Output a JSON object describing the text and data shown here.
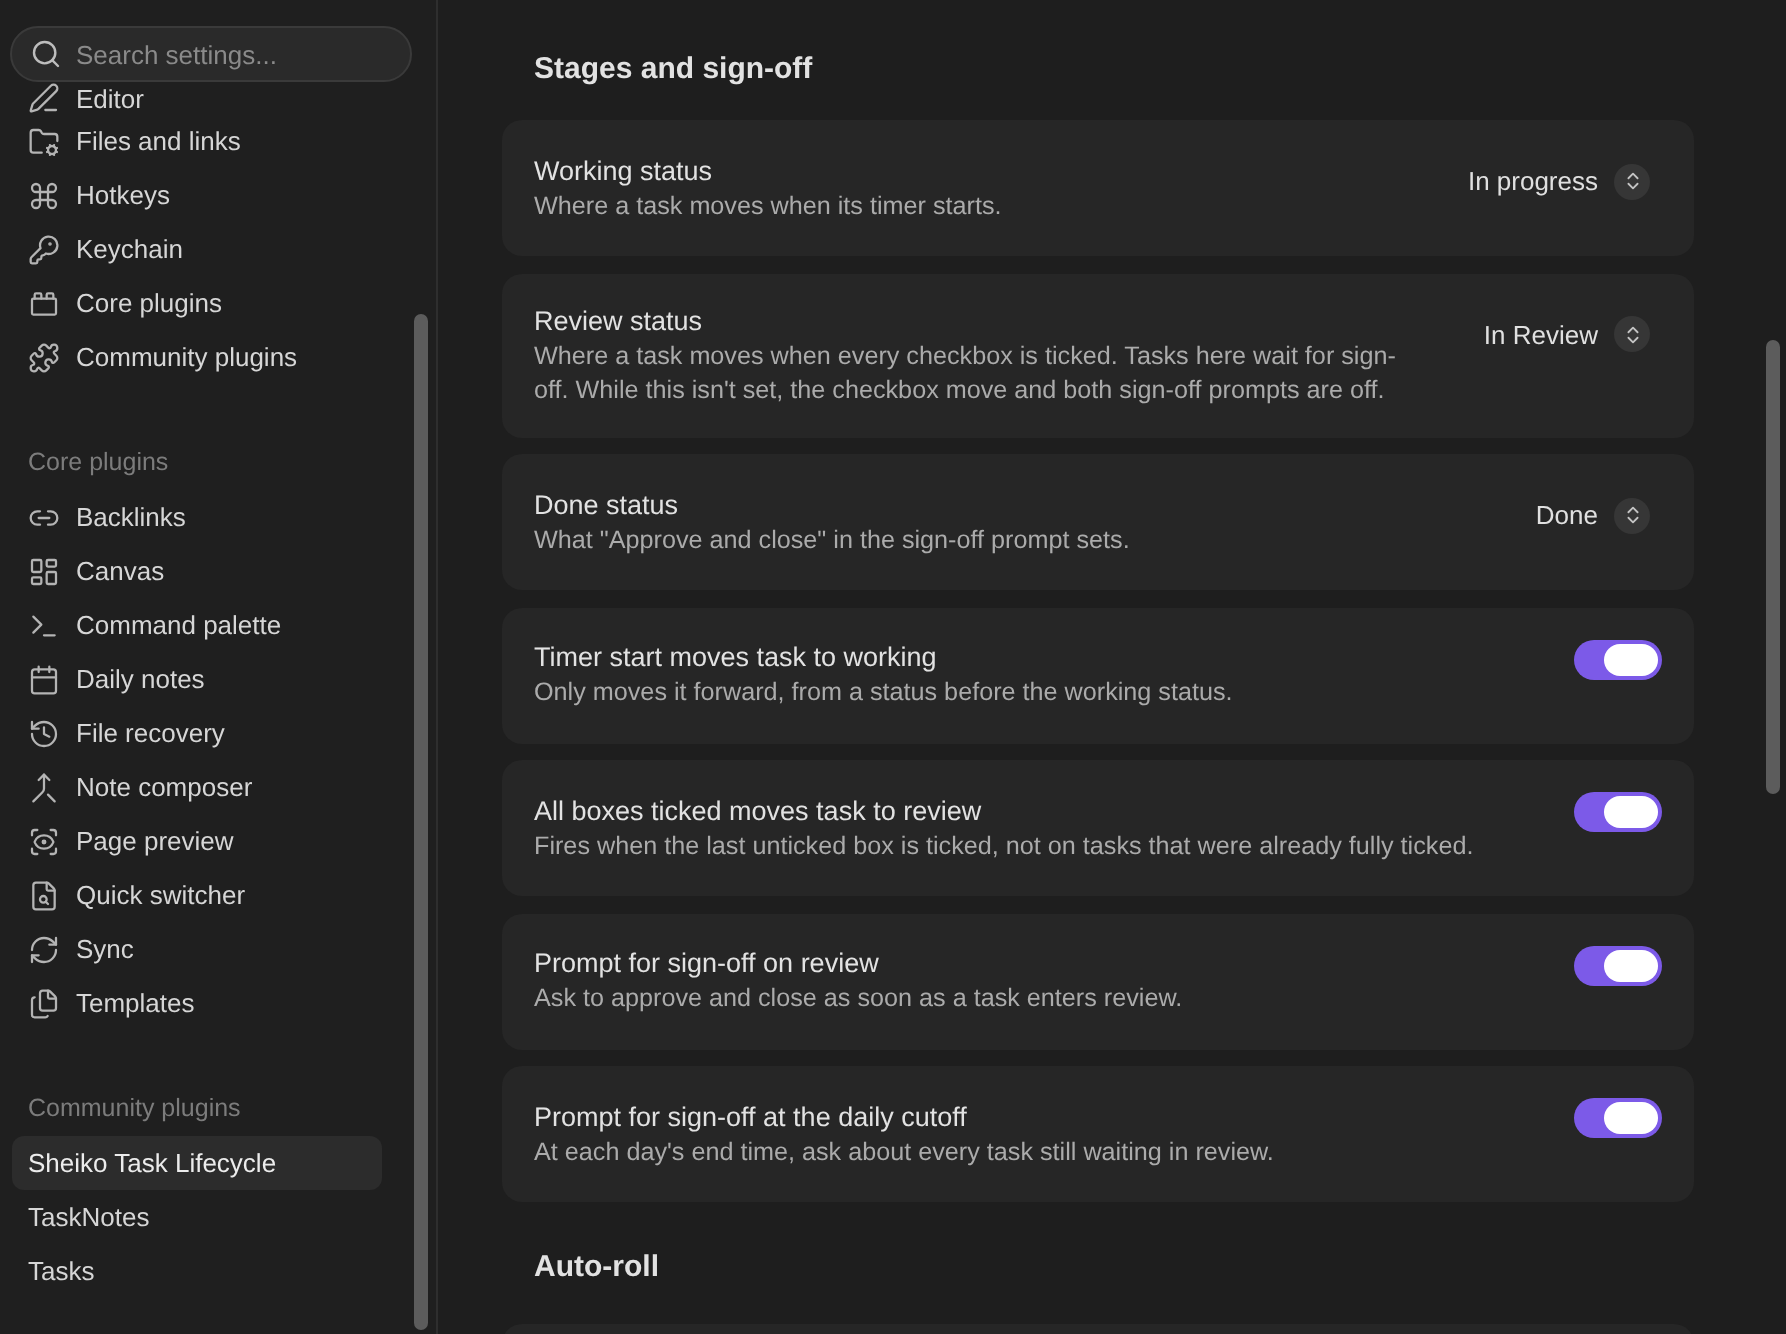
{
  "sidebar": {
    "search": {
      "placeholder": "Search settings..."
    },
    "groups": [
      {
        "items": [
          {
            "label": "Editor",
            "selected": false
          },
          {
            "label": "Files and links",
            "selected": false
          },
          {
            "label": "Hotkeys",
            "selected": false
          },
          {
            "label": "Keychain",
            "selected": false
          },
          {
            "label": "Core plugins",
            "selected": false
          },
          {
            "label": "Community plugins",
            "selected": false
          }
        ]
      },
      {
        "heading": "Core plugins",
        "items": [
          {
            "label": "Backlinks",
            "selected": false
          },
          {
            "label": "Canvas",
            "selected": false
          },
          {
            "label": "Command palette",
            "selected": false
          },
          {
            "label": "Daily notes",
            "selected": false
          },
          {
            "label": "File recovery",
            "selected": false
          },
          {
            "label": "Note composer",
            "selected": false
          },
          {
            "label": "Page preview",
            "selected": false
          },
          {
            "label": "Quick switcher",
            "selected": false
          },
          {
            "label": "Sync",
            "selected": false
          },
          {
            "label": "Templates",
            "selected": false
          }
        ]
      },
      {
        "heading": "Community plugins",
        "items": [
          {
            "label": "Sheiko Task Lifecycle",
            "selected": true
          },
          {
            "label": "TaskNotes",
            "selected": false
          },
          {
            "label": "Tasks",
            "selected": false
          }
        ]
      }
    ]
  },
  "content": {
    "sections": [
      {
        "heading": "Stages and sign-off",
        "settings": [
          {
            "kind": "dropdown",
            "name": "Working status",
            "description": "Where a task moves when its timer starts.",
            "value": "In progress"
          },
          {
            "kind": "dropdown",
            "name": "Review status",
            "description": "Where a task moves when every checkbox is ticked. Tasks here wait for sign-off. While this isn't set, the checkbox move and both sign-off prompts are off.",
            "value": "In Review"
          },
          {
            "kind": "dropdown",
            "name": "Done status",
            "description": "What \"Approve and close\" in the sign-off prompt sets.",
            "value": "Done"
          },
          {
            "kind": "toggle",
            "name": "Timer start moves task to working",
            "description": "Only moves it forward, from a status before the working status.",
            "on": true
          },
          {
            "kind": "toggle",
            "name": "All boxes ticked moves task to review",
            "description": "Fires when the last unticked box is ticked, not on tasks that were already fully ticked.",
            "on": true
          },
          {
            "kind": "toggle",
            "name": "Prompt for sign-off on review",
            "description": "Ask to approve and close as soon as a task enters review.",
            "on": true
          },
          {
            "kind": "toggle",
            "name": "Prompt for sign-off at the daily cutoff",
            "description": "At each day's end time, ask about every task still waiting in review.",
            "on": true
          }
        ]
      },
      {
        "heading": "Auto-roll"
      }
    ]
  }
}
